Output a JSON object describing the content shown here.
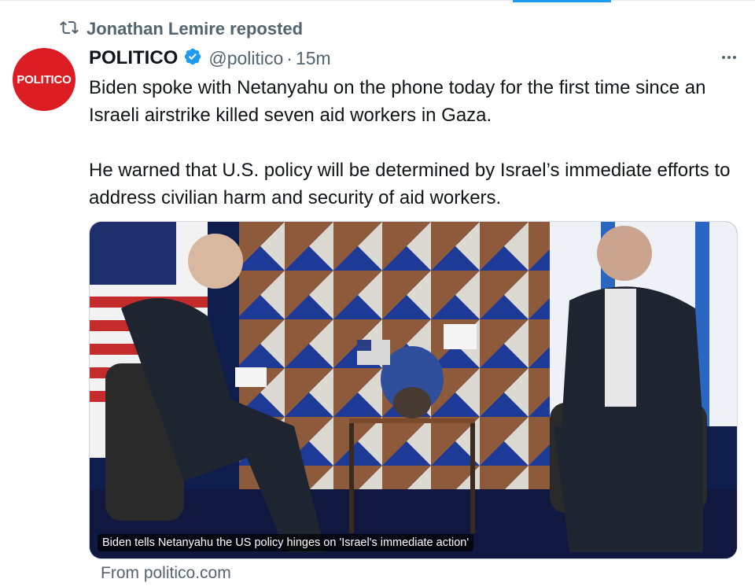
{
  "repost": {
    "icon": "repost-icon",
    "text": "Jonathan Lemire reposted"
  },
  "author": {
    "avatar_label": "POLITICO",
    "avatar_color": "#dd1d24",
    "name": "POLITICO",
    "verified_icon": "verified-badge-icon",
    "handle": "@politico",
    "separator": "·",
    "time": "15m"
  },
  "more_icon": "more-options-icon",
  "tweet": {
    "paragraph_1": "Biden spoke with Netanyahu on the phone today for the first time since an Israeli airstrike killed seven aid workers in Gaza.",
    "paragraph_2": "He warned that U.S. policy will be determined by Israel’s immediate efforts to address civilian harm and security of aid workers."
  },
  "card": {
    "caption": "Biden tells Netanyahu the US policy hinges on 'Israel's immediate action'",
    "source": "From politico.com"
  },
  "colors": {
    "text_primary": "#0f1419",
    "text_secondary": "#536471",
    "accent": "#1d9bf0"
  }
}
